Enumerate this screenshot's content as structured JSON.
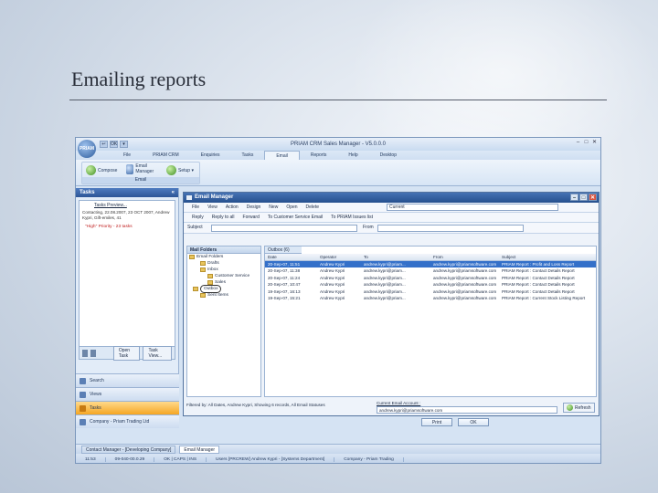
{
  "slide": {
    "title": "Emailing reports"
  },
  "app": {
    "title": "PRIAM CRM Sales Manager - V5.0.0.0",
    "orb_label": "PRIAM",
    "quick_access": [
      "↩",
      "OK",
      "▾"
    ],
    "window_buttons": [
      "–",
      "□",
      "✕"
    ],
    "menu_tabs": [
      "File",
      "PRIAM CRM",
      "Enquiries",
      "Tasks",
      "Email",
      "Reports",
      "Help",
      "Desktop"
    ],
    "active_tab": "Email",
    "ribbon": {
      "compose": "Compose",
      "email_manager": "Email Manager",
      "setup": "Setup ▾",
      "group_label": "Email"
    }
  },
  "tasks": {
    "header": "Tasks",
    "collapse": "«",
    "panel_title": "Tasks Preview...",
    "panel_text": "Contacting, 22.08.2007, 23 OCT 2007, Andrew Kypri, Gift-emiles, 41",
    "item": "\"High\" Priority - 23 tasks",
    "btn_open": "Open Task",
    "btn_view": "Task View..."
  },
  "nav": {
    "items": [
      "Search",
      "Views",
      "Tasks",
      "Company - Priam Trading Ltd"
    ],
    "selected": "Tasks"
  },
  "email_manager": {
    "title": "Email Manager",
    "toolbar1": [
      "File",
      "View",
      "Action",
      "Design",
      "New",
      "Open",
      "Delete"
    ],
    "toolbar1_combo": "Current",
    "toolbar2": [
      "Reply",
      "Reply to all",
      "Forward",
      "To Customer Service Email",
      "To PRIAM Issues list"
    ],
    "subject_label": "Subject",
    "from_label": "From",
    "folders": {
      "header": "Mail Folders",
      "items": [
        "Email Folders",
        "Drafts",
        "Inbox",
        "Customer Service",
        "Sales",
        "Outbox",
        "Sent Items"
      ],
      "circled": "Outbox"
    },
    "outbox": {
      "tab": "Outbox (6)",
      "columns": [
        "Date",
        "Operator",
        "To",
        "From",
        "Subject"
      ],
      "rows": [
        [
          "20-Sep-07, 11:51",
          "Andrew Kypri",
          "andrew.kypri@priam...",
          "andrew.kypri@priamsoftware.com",
          "PRIAM Report : Profit and Loss Report"
        ],
        [
          "20-Sep-07, 11:38",
          "Andrew Kypri",
          "andrew.kypri@priam...",
          "andrew.kypri@priamsoftware.com",
          "PRIAM Report : Contact Details Report"
        ],
        [
          "20-Sep-07, 11:24",
          "Andrew Kypri",
          "andrew.kypri@priam...",
          "andrew.kypri@priamsoftware.com",
          "PRIAM Report : Contact Details Report"
        ],
        [
          "20-Sep-07, 10:47",
          "Andrew Kypri",
          "andrew.kypri@priam...",
          "andrew.kypri@priamsoftware.com",
          "PRIAM Report : Contact Details Report"
        ],
        [
          "19-Sep-07, 16:13",
          "Andrew Kypri",
          "andrew.kypri@priam...",
          "andrew.kypri@priamsoftware.com",
          "PRIAM Report : Contact Details Report"
        ],
        [
          "19-Sep-07, 15:21",
          "Andrew Kypri",
          "andrew.kypri@priam...",
          "andrew.kypri@priamsoftware.com",
          "PRIAM Report : Current Stock Listing Report"
        ]
      ]
    },
    "filter_text": "Filtered by: All Dates, Andrew Kypri, Showing 6 records, All Email Statuses",
    "account_label": "Current Email Account :",
    "account_value": "andrew.kypri@priamsoftware.com",
    "refresh": "Refresh",
    "btn_print": "Print",
    "btn_ok": "OK"
  },
  "taskbar": {
    "items": [
      "Contact Manager - [Developing Company]",
      "Email Manager"
    ],
    "active": "Email Manager"
  },
  "status": [
    "11:53",
    "09-040-00.0.29",
    "OK | CAPS | INS",
    "Users [PRCREW] Andrew Kypri - [Systems Department]",
    "Company - Priam Trading"
  ]
}
